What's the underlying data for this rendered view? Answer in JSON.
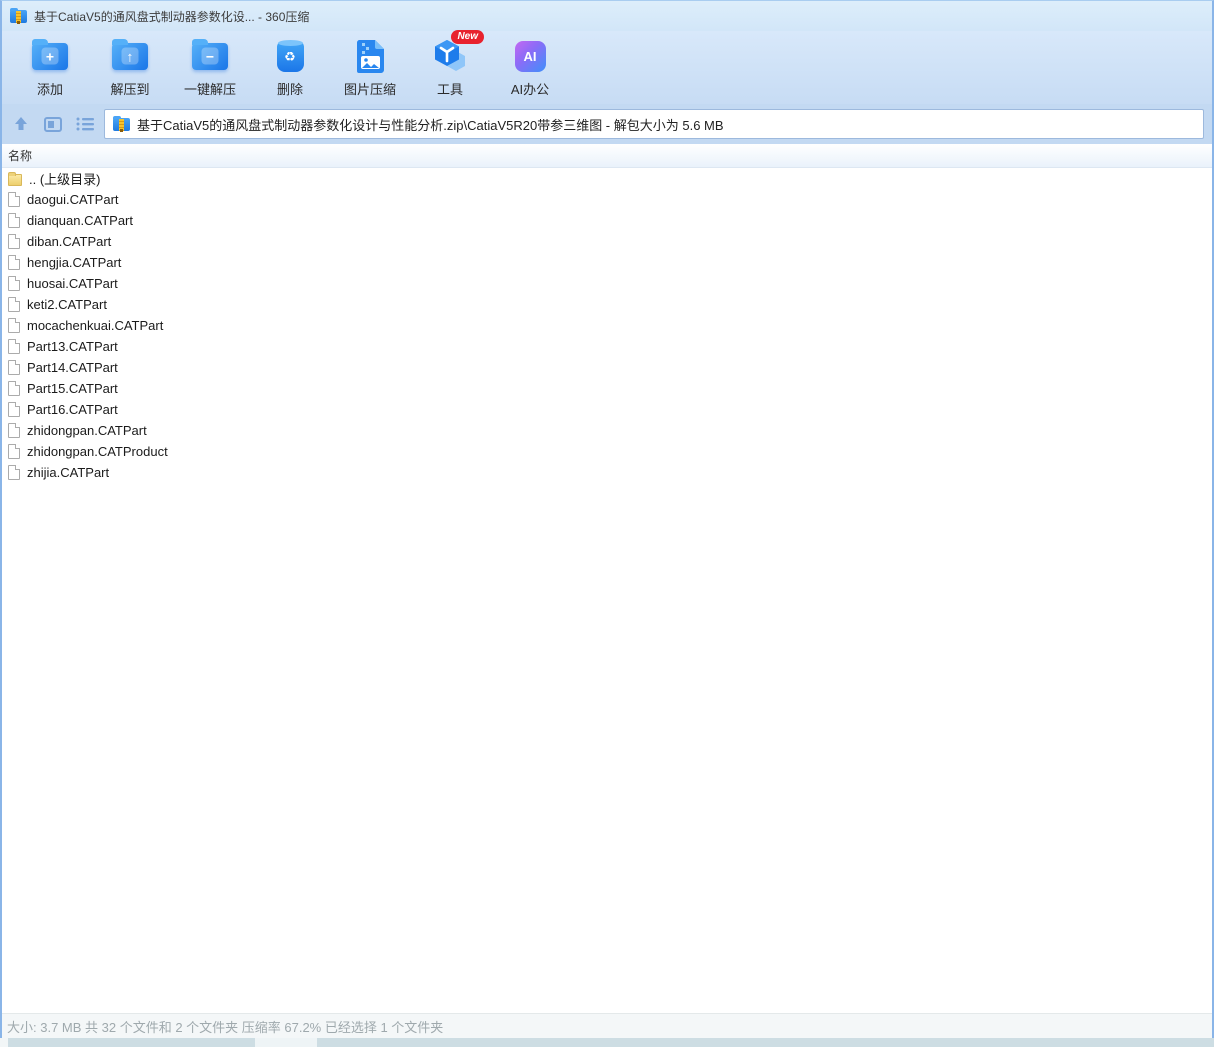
{
  "window": {
    "title": "基于CatiaV5的通风盘式制动器参数化设... - 360压缩",
    "app_icon": "zip-archive-icon"
  },
  "toolbar": {
    "buttons": [
      {
        "label": "添加",
        "icon": "add-archive-icon"
      },
      {
        "label": "解压到",
        "icon": "extract-to-icon"
      },
      {
        "label": "一键解压",
        "icon": "one-click-extract-icon"
      },
      {
        "label": "删除",
        "icon": "delete-icon"
      },
      {
        "label": "图片压缩",
        "icon": "image-compress-icon"
      },
      {
        "label": "工具",
        "icon": "tools-cube-icon",
        "badge": "New"
      },
      {
        "label": "AI办公",
        "icon": "ai-office-icon",
        "icon_text": "AI"
      }
    ]
  },
  "addressbar": {
    "path": "基于CatiaV5的通风盘式制动器参数化设计与性能分析.zip\\CatiaV5R20带参三维图 - 解包大小为 5.6 MB",
    "nav_icons": [
      "up-icon",
      "panel-view-icon",
      "list-view-icon"
    ]
  },
  "list": {
    "header": "名称",
    "parent_label": ".. (上级目录)",
    "files": [
      "daogui.CATPart",
      "dianquan.CATPart",
      "diban.CATPart",
      "hengjia.CATPart",
      "huosai.CATPart",
      "keti2.CATPart",
      "mocachenkuai.CATPart",
      "Part13.CATPart",
      "Part14.CATPart",
      "Part15.CATPart",
      "Part16.CATPart",
      "zhidongpan.CATPart",
      "zhidongpan.CATProduct",
      "zhijia.CATPart"
    ]
  },
  "statusbar": {
    "text": "大小: 3.7 MB 共 32 个文件和 2 个文件夹 压缩率 67.2% 已经选择 1 个文件夹"
  },
  "colors": {
    "titlebar_bg": "#d7e9fa",
    "toolbar_bg_bottom": "#c7dcf4",
    "accent_blue": "#1b76e8",
    "badge_red": "#e8222e",
    "ai_gradient_start": "#c468f2",
    "ai_gradient_end": "#3e8ffa",
    "status_text": "#9fa9ad"
  }
}
